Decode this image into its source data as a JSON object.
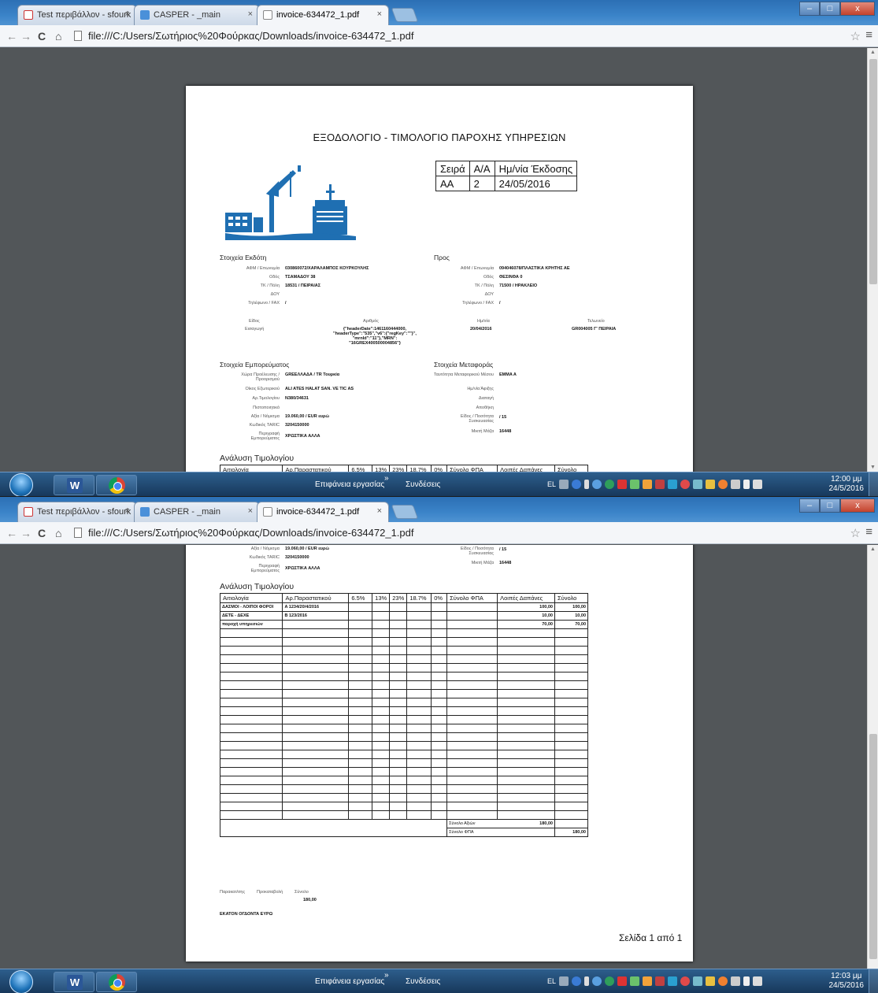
{
  "browser": {
    "tabs": [
      {
        "label": "Test περιβάλλον - sfourk",
        "close": "×"
      },
      {
        "label": "CASPER - _main",
        "close": "×"
      },
      {
        "label": "invoice-634472_1.pdf",
        "close": "×"
      }
    ],
    "url": "file:///C:/Users/Σωτήριος%20Φούρκας/Downloads/invoice-634472_1.pdf",
    "win_buttons": {
      "min": "–",
      "max": "□",
      "close": "x"
    }
  },
  "invoice": {
    "title": "ΕΞΟΔΟΛΟΓΙΟ - ΤΙΜΟΛΟΓΙΟ ΠΑΡΟΧΗΣ ΥΠΗΡΕΣΙΩΝ",
    "series_header": [
      "Σειρά",
      "Α/Α",
      "Ημ/νία Έκδοσης"
    ],
    "series_values": [
      "ΑΑ",
      "2",
      "24/05/2016"
    ],
    "issuer": {
      "heading": "Στοιχεία Εκδότη",
      "afm_label": "ΑΦΜ / Επωνυμία",
      "afm_value": "030860072/ΧΑΡΑΛΑΜΠΟΣ ΚΟΥΡΚΟΥΛΗΣ",
      "street_label": "Οδός",
      "street_value": "ΤΣΑΜΑΔΟΥ 38",
      "tk_label": "ΤΚ / Πόλη",
      "tk_value": "18531 / ΠΕΙΡΑΙΑΣ",
      "doy_label": "ΔΟΥ",
      "phone_label": "Τηλέφωνο / FAX",
      "phone_value": "/"
    },
    "recipient": {
      "heading": "Προς",
      "afm_label": "ΑΦΜ / Επωνυμία",
      "afm_value": "094046078/ΠΛΑΣΤΙΚΑ ΚΡΗΤΗΣ ΑΕ",
      "street_label": "Οδός",
      "street_value": "ΘΕΣΙΝΘΑ 0",
      "tk_label": "ΤΚ / Πόλη",
      "tk_value": "71500 / ΗΡΑΚΛΕΙΟ",
      "doy_label": "ΔΟΥ",
      "phone_label": "Τηλέφωνο / FAX",
      "phone_value": "/"
    },
    "customs": {
      "type_label": "Είδος",
      "type_value": "Εισαγωγή",
      "number_label": "Αριθμός",
      "number_value": "{\"headerDate\":1461160444000, \"headerType\":\"535\",\"v6\":{\"regKey\":\"\"}\", \"mrnId\":\"11\"},\"MRN\": \"16GREX400500004856\"}",
      "date_label": "Ημ/νία",
      "date_value": "20/04/2016",
      "office_label": "Τελωνείο",
      "office_value": "GR004005 Γ' ΠΕΙΡΑΙΑ"
    },
    "goods": {
      "heading": "Στοιχεία Εμπορεύματος",
      "origin_label": "Χώρα Προέλευσης / Προορισμού",
      "origin_value": "GREΕΛΛΑΔΑ / TR Τουρκία",
      "exporter_label": "Οίκος Εξωτερικού",
      "exporter_value": "ALI ATES HALAT SAN. VE TIC AS",
      "invoice_no_label": "Αρ.Τιμολογίου",
      "invoice_no_value": "N380/34631",
      "cert_label": "Πιστοποιητικό",
      "value_label": "Αξία / Νόμισμα",
      "value_value": "19.060,00 / EUR ευρώ",
      "taric_label": "Κωδικός TARIC",
      "taric_value": "3204150000",
      "desc_label": "Περιγραφή Εμπορεύματος",
      "desc_value": "ΧΡΩΣΤΙΚΑ ΑΛΛΑ"
    },
    "transport": {
      "heading": "Στοιχεία Μεταφοράς",
      "id_label": "Ταυτότητα Μεταφορικού Μέσου",
      "id_value": "EMMA A",
      "arrival_label": "Ημ/νία Άφιξης",
      "dispatch_label": "Διαταγή",
      "storage_label": "Αποθήκη",
      "pkg_label": "Είδος / Ποσότητα Συσκευασίας",
      "pkg_value": "/ 15",
      "weight_label": "Μικτή Μάζα",
      "weight_value": "16448"
    },
    "analysis": {
      "title": "Ανάλυση Τιμολογίου",
      "headers": [
        "Αιτιολογία",
        "Αρ.Παραστατικού",
        "6.5%",
        "13%",
        "23%",
        "18.7%",
        "0%",
        "Σύνολο ΦΠΑ",
        "Λοιπές Δαπάνες",
        "Σύνολο"
      ],
      "rows": [
        [
          "ΔΑΣΜΟΙ - ΛΟΙΠΟΙ ΦΟΡΟΙ",
          "A 1234/20/4/2016",
          "",
          "",
          "",
          "",
          "",
          "",
          "100,00",
          "100,00"
        ],
        [
          "ΔΕΤΕ - ΔΕΧΕ",
          "B 123/2016",
          "",
          "",
          "",
          "",
          "",
          "",
          "10,00",
          "10,00"
        ],
        [
          "παροχή υπηρεσιών",
          "",
          "",
          "",
          "",
          "",
          "",
          "",
          "70,00",
          "70,00"
        ]
      ],
      "total_values_label": "Σύνολο Αξιών",
      "total_values": "180,00",
      "total_vat_label": "Σύνολο ΦΠΑ",
      "grand_total": "180,00"
    },
    "footer": {
      "withholding_label": "Παρακατ/σης",
      "prepayment_label": "Προκαταβολή",
      "total_label": "Σύνολο",
      "total_value": "180,00",
      "amount_words": "ΕΚΑΤΟΝ ΟΓΔΟΝΤΑ ΕΥΡΩ",
      "page_label": "Σελίδα 1 από 1"
    }
  },
  "taskbar": {
    "desktop_label": "Επιφάνεια εργασίας",
    "links_label": "Συνδέσεις",
    "lang": "EL",
    "clock1_time": "12:00 μμ",
    "clock1_date": "24/5/2016",
    "clock2_time": "12:03 μμ",
    "clock2_date": "24/5/2016"
  },
  "colors": {
    "logo_blue": "#1f6fb2",
    "taskbar": "#17385b",
    "pdf_background": "#525659"
  },
  "icons": [
    "gmail-icon",
    "casper-icon",
    "pdf-page-icon",
    "back-icon",
    "forward-icon",
    "reload-icon",
    "home-icon",
    "star-icon",
    "menu-icon",
    "start-orb-icon",
    "word-icon",
    "chrome-icon"
  ]
}
